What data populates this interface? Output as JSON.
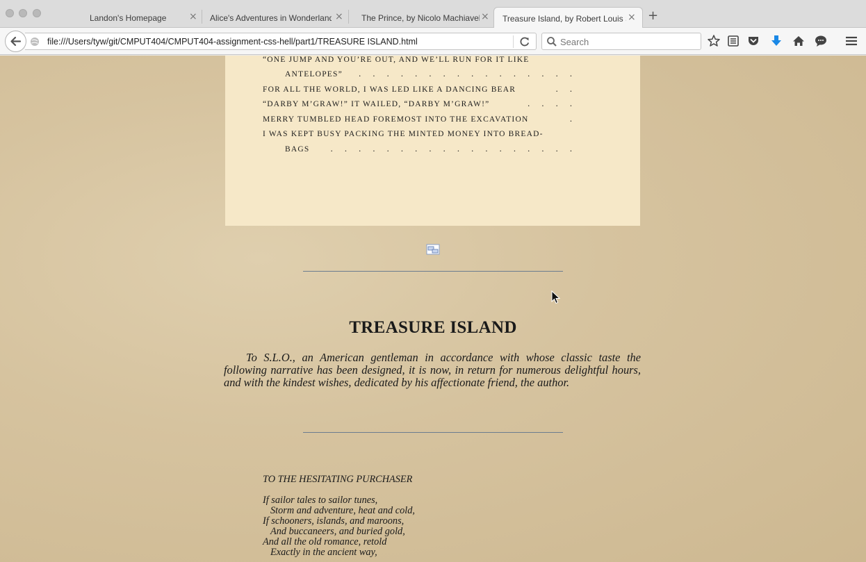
{
  "tabs": [
    {
      "title": "Landon's Homepage",
      "active": false
    },
    {
      "title": "Alice's Adventures in Wonderland, ...",
      "active": false
    },
    {
      "title": "The Prince, by Nicolo Machiavelli",
      "active": false
    },
    {
      "title": "Treasure Island, by Robert Louis St...",
      "active": true
    }
  ],
  "tab_close_glyph": "×",
  "new_tab_glyph": "+",
  "nav": {
    "url": "file:///Users/tyw/git/CMPUT404/CMPUT404-assignment-css-hell/part1/TREASURE ISLAND.html",
    "search_placeholder": "Search"
  },
  "toolbar_icons": [
    "bookmark-star-icon",
    "reading-list-icon",
    "pocket-icon",
    "downloads-icon",
    "home-icon",
    "chat-icon",
    "menu-icon"
  ],
  "illustrations": [
    {
      "text": "“one jump and you’re out, and we’ll run for it like",
      "continuation": false,
      "dots": ""
    },
    {
      "text": "antelopes”",
      "continuation": true,
      "dots": ". . . . . . . . . . . . . . . ."
    },
    {
      "text": "for all the world, i was led like a dancing bear",
      "continuation": false,
      "dots": ". ."
    },
    {
      "text": "“darby m’graw!” it wailed, “darby m’graw!”",
      "continuation": false,
      "dots": ". . . ."
    },
    {
      "text": "merry tumbled head foremost into the excavation",
      "continuation": false,
      "dots": "."
    },
    {
      "text": "i was kept busy packing the minted money into bread-",
      "continuation": false,
      "dots": ""
    },
    {
      "text": "bags",
      "continuation": true,
      "dots": ". . . . . . . . . . . . . . . . . ."
    }
  ],
  "book": {
    "title": "TREASURE ISLAND",
    "dedication": "To S.L.O., an American gentleman in accordance with whose classic taste the following narrative has been designed, it is now, in return for numerous delightful hours, and with the kindest wishes, dedicated by his affectionate friend, the author.",
    "poem_heading": "TO THE HESITATING PURCHASER",
    "poem_lines": [
      {
        "text": "If sailor tales to sailor tunes,",
        "indent": false
      },
      {
        "text": "Storm and adventure, heat and cold,",
        "indent": true
      },
      {
        "text": "If schooners, islands, and maroons,",
        "indent": false
      },
      {
        "text": "And buccaneers, and buried gold,",
        "indent": true
      },
      {
        "text": "And all the old romance, retold",
        "indent": false
      },
      {
        "text": "Exactly in the ancient way,",
        "indent": true
      }
    ]
  },
  "colors": {
    "page_background": "#d6c39f",
    "plate_background": "#f6e8c8",
    "rule_color": "#6b7c8f",
    "downloads_accent": "#1a88e6"
  }
}
